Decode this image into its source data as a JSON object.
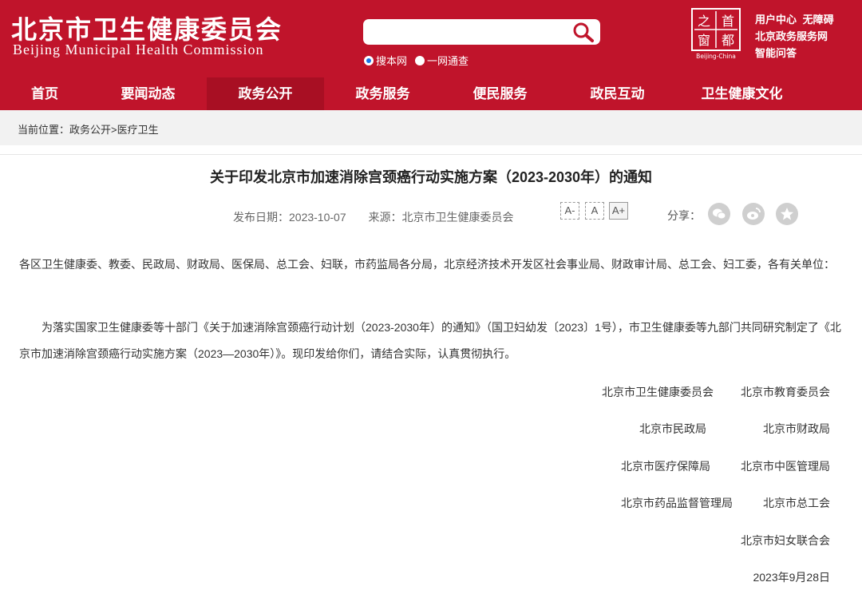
{
  "header": {
    "logo_cn": "北京市卫生健康委员会",
    "logo_en": "Beijing Municipal Health Commission",
    "search": {
      "value": "",
      "options": [
        {
          "label": "搜本网",
          "checked": true
        },
        {
          "label": "一网通查",
          "checked": false
        }
      ]
    },
    "seal": {
      "chars": [
        "之",
        "首",
        "窗",
        "都"
      ],
      "caption": "Beijing-China"
    },
    "top_links": {
      "user_center": "用户中心",
      "accessibility": "无障碍",
      "gov_service": "北京政务服务网",
      "smart_qa": "智能问答"
    },
    "nav": [
      "首页",
      "要闻动态",
      "政务公开",
      "政务服务",
      "便民服务",
      "政民互动",
      "卫生健康文化"
    ],
    "nav_active_index": 2
  },
  "breadcrumb": {
    "prefix": "当前位置：",
    "items": [
      "政务公开",
      "医疗卫生"
    ],
    "separator": ">"
  },
  "article": {
    "title": "关于印发北京市加速消除宫颈癌行动实施方案（2023-2030年）的通知",
    "date_label": "发布日期：",
    "date": "2023-10-07",
    "source_label": "来源：",
    "source": "北京市卫生健康委员会",
    "font_buttons": [
      "A-",
      "A",
      "A+"
    ],
    "share_label": "分享：",
    "share_icons": [
      "wechat-icon",
      "weibo-icon",
      "favorite-icon"
    ],
    "recipients": "各区卫生健康委、教委、民政局、财政局、医保局、总工会、妇联，市药监局各分局，北京经济技术开发区社会事业局、财政审计局、总工会、妇工委，各有关单位：",
    "body": "为落实国家卫生健康委等十部门《关于加速消除宫颈癌行动计划（2023-2030年）的通知》（国卫妇幼发〔2023〕1号），市卫生健康委等九部门共同研究制定了《北京市加速消除宫颈癌行动实施方案（2023—2030年）》。现印发给你们，请结合实际，认真贯彻执行。",
    "signatories": [
      [
        "北京市卫生健康委员会",
        "北京市教育委员会"
      ],
      [
        "北京市民政局",
        "北京市财政局"
      ],
      [
        "北京市医疗保障局",
        "北京市中医管理局"
      ],
      [
        "北京市药品监督管理局",
        "北京市总工会"
      ],
      [
        "",
        "北京市妇女联合会"
      ]
    ],
    "sign_date": "2023年9月28日"
  },
  "colors": {
    "brand_red": "#c0142b",
    "nav_active": "#a80f23",
    "crumb_bg": "#f2f2f2"
  }
}
